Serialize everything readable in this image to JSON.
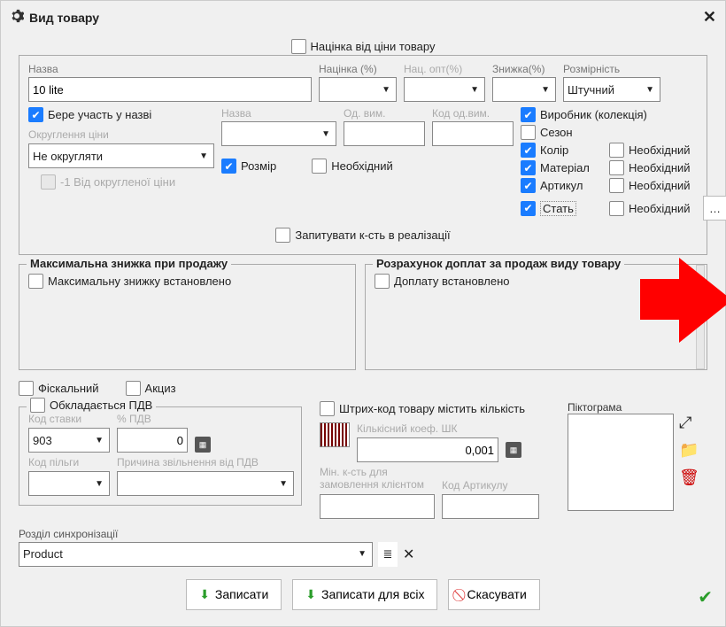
{
  "titlebar": {
    "title": "Вид товару"
  },
  "top": {
    "markup_from_price": "Націнка від ціни товару",
    "name_lbl": "Назва",
    "name_val": "10 lite",
    "markup_pct_lbl": "Націнка (%)",
    "wholesale_pct_lbl": "Нац. опт(%)",
    "discount_pct_lbl": "Знижка(%)",
    "dimension_lbl": "Розмірність",
    "dimension_val": "Штучний",
    "take_part_name": "Бере участь у назві",
    "name2_lbl": "Назва",
    "unit_lbl": "Од. вим.",
    "unit_code_lbl": "Код од.вим.",
    "rounding_lbl": "Округлення ціни",
    "rounding_val": "Не округляти",
    "size_chk": "Розмір",
    "required_chk": "Необхідний",
    "minus1_rounded": "-1 Від округленої ціни",
    "ask_qty": "Запитувати к-сть в реалізації",
    "right_checks": {
      "manufacturer": "Виробник (колекція)",
      "season": "Сезон",
      "color": "Колір",
      "material": "Матеріал",
      "article": "Артикул",
      "gender": "Стать",
      "required": "Необхідний"
    }
  },
  "max_discount": {
    "title": "Максимальна знижка при продажу",
    "set": "Максимальну знижку встановлено"
  },
  "surcharge": {
    "title": "Розрахунок доплат за продаж виду товару",
    "set": "Доплату встановлено"
  },
  "fiscal": "Фіскальний",
  "excise": "Акциз",
  "vat": {
    "apply": "Обкладається ПДВ",
    "rate_code_lbl": "Код ставки",
    "rate_code_val": "903",
    "pct_vat_lbl": "% ПДВ",
    "pct_vat_val": "0",
    "benefit_code_lbl": "Код пільги",
    "exempt_reason_lbl": "Причина звільнення від ПДВ"
  },
  "barcode": {
    "contains_qty": "Штрих-код товару містить кількість",
    "qty_coef_lbl": "Кількісний коеф. ШК",
    "qty_coef_val": "0,001",
    "min_qty_lbl": "Мін. к-сть для замовлення клієнтом",
    "article_code_lbl": "Код Артикулу"
  },
  "pictogram_lbl": "Піктограма",
  "sync_section_lbl": "Розділ синхронізації",
  "sync_section_val": "Product",
  "buttons": {
    "save": "Записати",
    "save_all": "Записати для всіх",
    "cancel": "Скасувати"
  }
}
